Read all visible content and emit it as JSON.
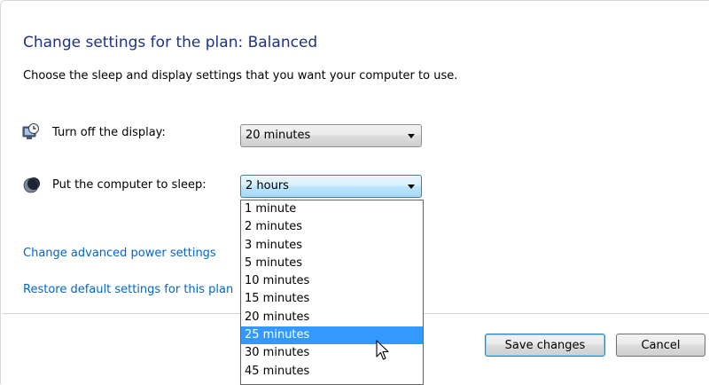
{
  "page": {
    "title": "Change settings for the plan: Balanced",
    "subtitle": "Choose the sleep and display settings that you want your computer to use."
  },
  "display_setting": {
    "label": "Turn off the display:",
    "icon": "monitor-clock-icon",
    "value": "20 minutes"
  },
  "sleep_setting": {
    "label": "Put the computer to sleep:",
    "icon": "moon-icon",
    "value": "2 hours",
    "dropdown_open": true,
    "highlighted_option": "25 minutes",
    "options": [
      "1 minute",
      "2 minutes",
      "3 minutes",
      "5 minutes",
      "10 minutes",
      "15 minutes",
      "20 minutes",
      "25 minutes",
      "30 minutes",
      "45 minutes"
    ]
  },
  "links": {
    "advanced": "Change advanced power settings",
    "restore": "Restore default settings for this plan"
  },
  "buttons": {
    "save": "Save changes",
    "cancel": "Cancel"
  },
  "colors": {
    "title": "#1e3287",
    "link": "#0066cc",
    "highlight": "#3399ff"
  }
}
